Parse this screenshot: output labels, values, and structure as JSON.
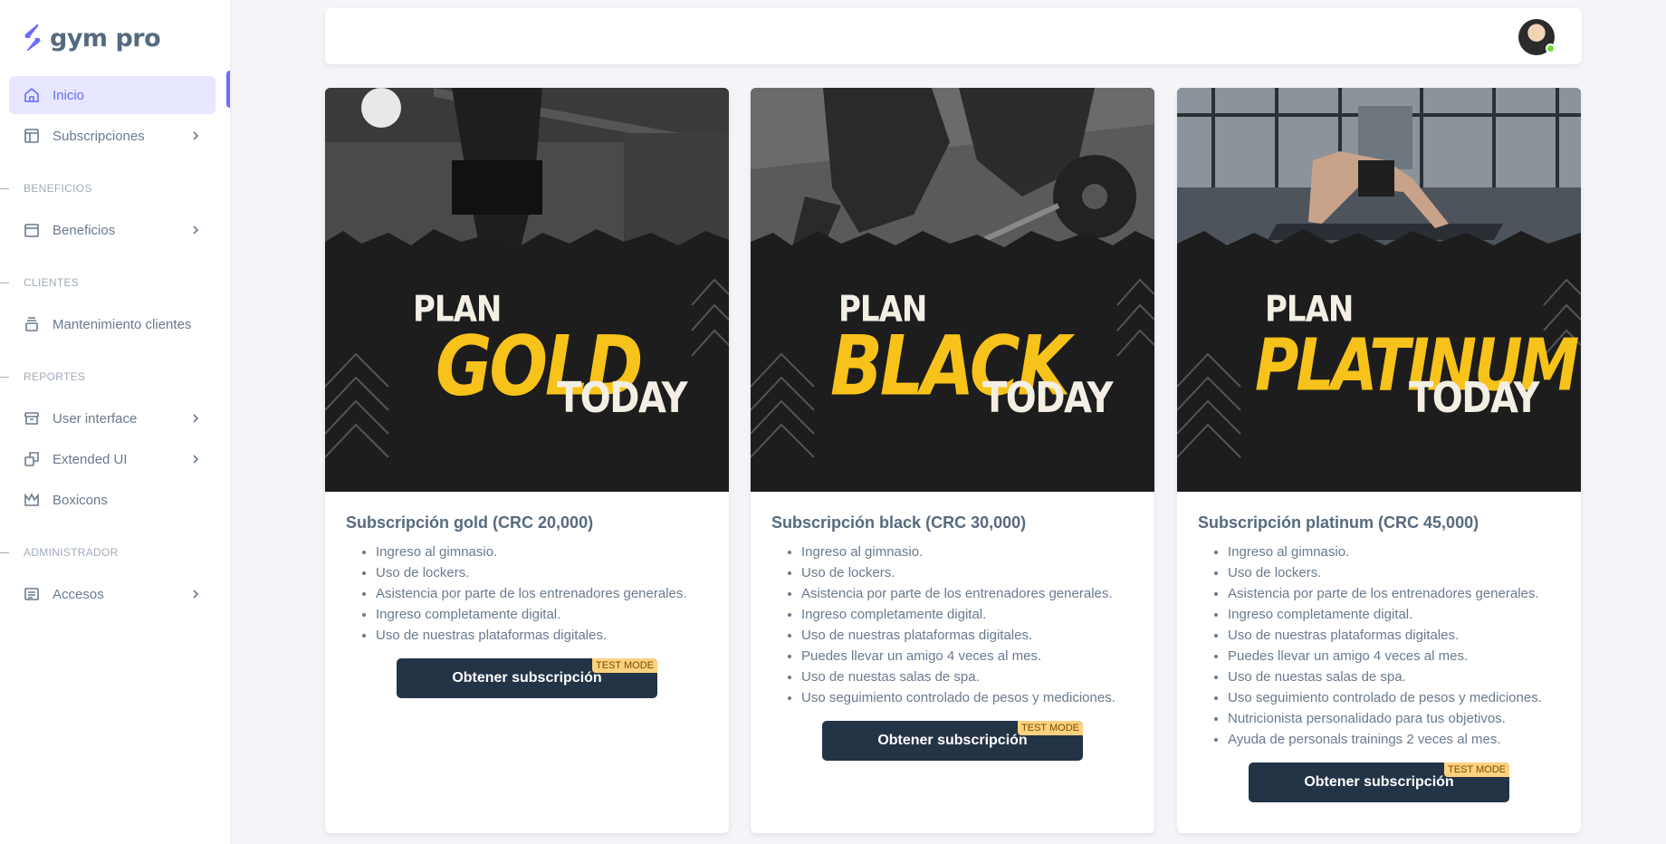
{
  "brand": {
    "name": "gym pro"
  },
  "sidebar": {
    "items": [
      {
        "label": "Inicio",
        "icon": "home-icon"
      },
      {
        "label": "Subscripciones",
        "icon": "layout-icon"
      }
    ],
    "sections": [
      {
        "header": "BENEFICIOS",
        "items": [
          {
            "label": "Beneficios",
            "icon": "window-icon"
          }
        ]
      },
      {
        "header": "CLIENTES",
        "items": [
          {
            "label": "Mantenimiento clientes",
            "icon": "stack-icon"
          }
        ]
      },
      {
        "header": "REPORTES",
        "items": [
          {
            "label": "User interface",
            "icon": "archive-icon"
          },
          {
            "label": "Extended UI",
            "icon": "copy-icon"
          },
          {
            "label": "Boxicons",
            "icon": "crown-icon"
          }
        ]
      },
      {
        "header": "ADMINISTRADOR",
        "items": [
          {
            "label": "Accesos",
            "icon": "detail-icon"
          }
        ]
      }
    ]
  },
  "cards": [
    {
      "plan_word": "PLAN",
      "plan_name": "GOLD",
      "plan_today": "TODAY",
      "title": "Subscripción gold",
      "price": "(CRC 20,000)",
      "features": [
        "Ingreso al gimnasio.",
        "Uso de lockers.",
        "Asistencia por parte de los entrenadores generales.",
        "Ingreso completamente digital.",
        "Uso de nuestras plataformas digitales."
      ],
      "button": "Obtener subscripción",
      "badge": "TEST MODE"
    },
    {
      "plan_word": "PLAN",
      "plan_name": "BLACK",
      "plan_today": "TODAY",
      "title": "Subscripción black",
      "price": "(CRC 30,000)",
      "features": [
        "Ingreso al gimnasio.",
        "Uso de lockers.",
        "Asistencia por parte de los entrenadores generales.",
        "Ingreso completamente digital.",
        "Uso de nuestras plataformas digitales.",
        "Puedes llevar un amigo 4 veces al mes.",
        "Uso de nuestas salas de spa.",
        "Uso seguimiento controlado de pesos y mediciones."
      ],
      "button": "Obtener subscripción",
      "badge": "TEST MODE"
    },
    {
      "plan_word": "PLAN",
      "plan_name": "PLATINUM",
      "plan_today": "TODAY",
      "title": "Subscripción platinum",
      "price": "(CRC 45,000)",
      "features": [
        "Ingreso al gimnasio.",
        "Uso de lockers.",
        "Asistencia por parte de los entrenadores generales.",
        "Ingreso completamente digital.",
        "Uso de nuestras plataformas digitales.",
        "Puedes llevar un amigo 4 veces al mes.",
        "Uso de nuestas salas de spa.",
        "Uso seguimiento controlado de pesos y mediciones.",
        "Nutricionista personalidado para tus objetivos.",
        "Ayuda de personals trainings 2 veces al mes."
      ],
      "button": "Obtener subscripción",
      "badge": "TEST MODE"
    }
  ],
  "colors": {
    "accent": "#696cff",
    "plan_yellow": "#f7c21a",
    "button": "#233446",
    "badge": "#fcd27e"
  }
}
